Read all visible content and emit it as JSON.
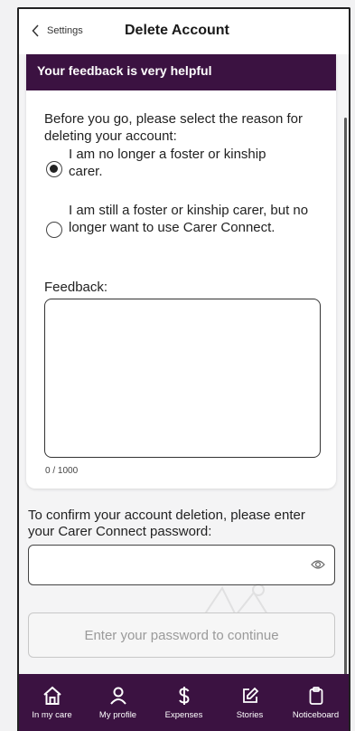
{
  "header": {
    "back_label": "Settings",
    "title": "Delete Account"
  },
  "card": {
    "banner": "Your feedback is very helpful",
    "intro": "Before you go, please select the reason for deleting your account:",
    "options": [
      {
        "label": "I am no longer a foster or kinship carer.",
        "selected": true
      },
      {
        "label": "I am still a foster or kinship carer, but no longer want to use Carer Connect.",
        "selected": false
      }
    ],
    "feedback_label": "Feedback:",
    "feedback_value": "",
    "counter": "0 / 1000"
  },
  "confirm": {
    "text": "To confirm your account deletion, please enter your Carer Connect password:",
    "password_value": "",
    "button_label": "Enter your password to continue"
  },
  "nav": {
    "items": [
      {
        "label": "In my care",
        "icon": "home-icon"
      },
      {
        "label": "My profile",
        "icon": "person-icon"
      },
      {
        "label": "Expenses",
        "icon": "dollar-icon"
      },
      {
        "label": "Stories",
        "icon": "edit-icon"
      },
      {
        "label": "Noticeboard",
        "icon": "clipboard-icon"
      }
    ]
  },
  "colors": {
    "brand": "#3b1241",
    "background": "#f4f4f5",
    "disabled_text": "#9a9a9a"
  }
}
